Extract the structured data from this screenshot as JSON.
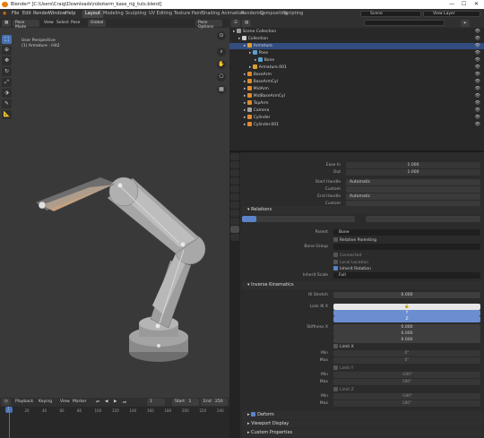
{
  "titlebar": {
    "title": "Blender* [C:\\Users\\Craig\\Downloads\\robotarm_base_rig_tuts.blend]",
    "min": "—",
    "max": "☐",
    "close": "✕"
  },
  "topbar": {
    "menus": [
      "File",
      "Edit",
      "Render",
      "Window",
      "Help"
    ],
    "workspaces": [
      "Layout",
      "Modeling",
      "Sculpting",
      "UV Editing",
      "Texture Paint",
      "Shading",
      "Animation",
      "Rendering",
      "Compositing",
      "Scripting"
    ],
    "scene_label": "Scene",
    "view_layer_label": "View Layer"
  },
  "viewport": {
    "mode": "Pose Mode",
    "menus": [
      "View",
      "Select",
      "Pose"
    ],
    "transform": "Global",
    "overlays": "Pose Options",
    "info_line1": "User Perspective",
    "info_line2": "(1) Armature : Hit2"
  },
  "timeline": {
    "menus": [
      "Playback",
      "Keying",
      "View",
      "Marker"
    ],
    "current_frame": "1",
    "start_label": "Start",
    "start": "1",
    "end_label": "End",
    "end": "250",
    "ticks": [
      "0",
      "20",
      "40",
      "60",
      "80",
      "100",
      "120",
      "140",
      "160",
      "180",
      "200",
      "220",
      "240"
    ]
  },
  "outliner": {
    "rows": [
      {
        "label": "Scene Collection",
        "depth": 0,
        "selected": false
      },
      {
        "label": "Collection",
        "depth": 1,
        "selected": false
      },
      {
        "label": "Armature",
        "depth": 2,
        "selected": true
      },
      {
        "label": "Pose",
        "depth": 3,
        "selected": false
      },
      {
        "label": "Bone",
        "depth": 4,
        "selected": false
      },
      {
        "label": "Armature.001",
        "depth": 3,
        "selected": false
      },
      {
        "label": "BaseArm",
        "depth": 2,
        "selected": false
      },
      {
        "label": "BaseArmCyl",
        "depth": 2,
        "selected": false
      },
      {
        "label": "MidArm",
        "depth": 2,
        "selected": false
      },
      {
        "label": "MidBaseArmCyl",
        "depth": 2,
        "selected": false
      },
      {
        "label": "TopArm",
        "depth": 2,
        "selected": false
      },
      {
        "label": "Camera",
        "depth": 2,
        "selected": false
      },
      {
        "label": "Cylinder",
        "depth": 2,
        "selected": false
      },
      {
        "label": "Cylinder.001",
        "depth": 2,
        "selected": false
      }
    ]
  },
  "properties": {
    "top_fields": [
      {
        "label": "Ease In",
        "value": "1.000"
      },
      {
        "label": "Out",
        "value": "1.000"
      },
      {
        "label": "Start Handle",
        "value": "Automatic"
      },
      {
        "label": "Custom",
        "value": ""
      },
      {
        "label": "End Handle",
        "value": "Automatic"
      },
      {
        "label": "Custom",
        "value": ""
      }
    ],
    "relations_header": "Relations",
    "parent_label": "Parent",
    "parent_value": "Bone",
    "relative_parenting": "Relative Parenting",
    "bone_group_label": "Bone Group",
    "connected": "Connected",
    "local_location": "Local Location",
    "inherit_rotation": "Inherit Rotation",
    "inherit_scale_label": "Inherit Scale",
    "inherit_scale_value": "Full",
    "ik_header": "Inverse Kinematics",
    "ik_stretch_label": "IK Stretch",
    "ik_stretch_value": "0.000",
    "lock_label": "Lock IK X",
    "lock_y": "Y",
    "lock_z": "Z",
    "stiffness_label": "Stiffness X",
    "stiffness_value": "0.000",
    "stiff_y": "0.000",
    "stiff_z": "0.000",
    "limit_x": "Limit X",
    "min_label": "Min",
    "max_label": "Max",
    "min_val": "0°",
    "max_val": "0°",
    "limit_y": "Limit Y",
    "min_y": "-180°",
    "max_y": "180°",
    "limit_z": "Limit Z",
    "min_z": "-180°",
    "max_z": "180°",
    "deform": "Deform",
    "viewport_display": "Viewport Display",
    "custom_properties": "Custom Properties"
  },
  "colors": {
    "accent": "#4772b3",
    "orange": "#e87d0d",
    "background": "#393939"
  }
}
